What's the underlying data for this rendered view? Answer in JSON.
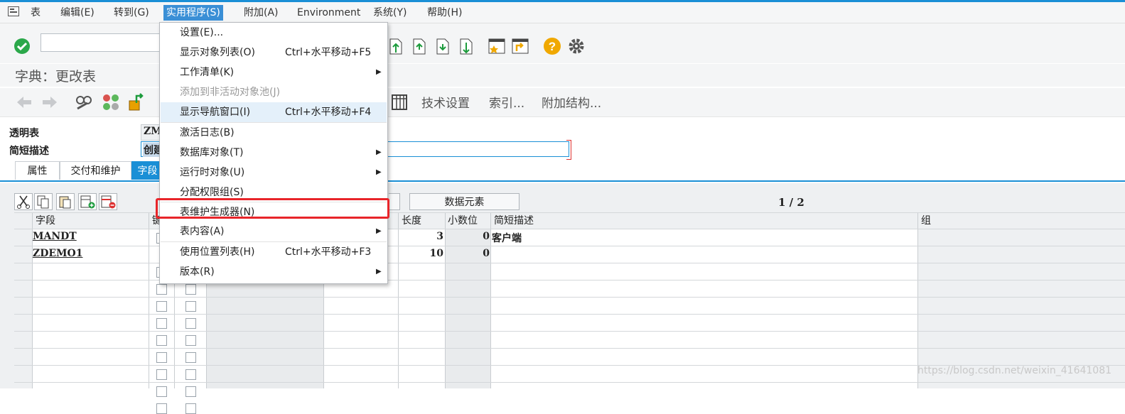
{
  "menubar": {
    "items": [
      "表",
      "编辑(E)",
      "转到(G)",
      "实用程序(S)",
      "附加(A)",
      "Environment",
      "系统(Y)",
      "帮助(H)"
    ]
  },
  "title": "字典：更改表",
  "app_toolbar": {
    "tech_settings": "技术设置",
    "index": "索引...",
    "append_struct": "附加结构..."
  },
  "fields": {
    "transparent_table_label": "透明表",
    "transparent_table_value": "ZM",
    "short_desc_label": "简短描述",
    "short_desc_value": "创建"
  },
  "tabs": [
    "属性",
    "交付和维护",
    "字段"
  ],
  "data_element_button": "数据元素",
  "pager": "1 / 2",
  "table": {
    "headers": {
      "field": "字段",
      "key": "键",
      "length": "长度",
      "decimals": "小数位",
      "short_desc": "简短描述",
      "group": "组"
    },
    "rows": [
      {
        "field": "MANDT",
        "length": "3",
        "decimals": "0",
        "desc": "客户端"
      },
      {
        "field": "ZDEMO1",
        "length": "10",
        "decimals": "0",
        "desc": ""
      }
    ]
  },
  "dropdown": {
    "items": [
      {
        "label": "设置(E)...",
        "shortcut": "",
        "submenu": false,
        "disabled": false
      },
      {
        "label": "显示对象列表(O)",
        "shortcut": "Ctrl+水平移动+F5",
        "submenu": false,
        "disabled": false
      },
      {
        "label": "工作清单(K)",
        "shortcut": "",
        "submenu": true,
        "disabled": false
      },
      {
        "label": "添加到非活动对象池(J)",
        "shortcut": "",
        "submenu": false,
        "disabled": true
      },
      {
        "label": "显示导航窗口(I)",
        "shortcut": "Ctrl+水平移动+F4",
        "submenu": false,
        "disabled": false
      },
      {
        "label": "激活日志(B)",
        "shortcut": "",
        "submenu": false,
        "disabled": false
      },
      {
        "label": "数据库对象(T)",
        "shortcut": "",
        "submenu": true,
        "disabled": false
      },
      {
        "label": "运行时对象(U)",
        "shortcut": "",
        "submenu": true,
        "disabled": false
      },
      {
        "label": "分配权限组(S)",
        "shortcut": "",
        "submenu": false,
        "disabled": false
      },
      {
        "label": "表维护生成器(N)",
        "shortcut": "",
        "submenu": false,
        "disabled": false
      },
      {
        "label": "表内容(A)",
        "shortcut": "",
        "submenu": true,
        "disabled": false
      },
      {
        "label": "使用位置列表(H)",
        "shortcut": "Ctrl+水平移动+F3",
        "submenu": false,
        "disabled": false
      },
      {
        "label": "版本(R)",
        "shortcut": "",
        "submenu": true,
        "disabled": false
      }
    ]
  },
  "watermark": "https://blog.csdn.net/weixin_41641081",
  "colors": {
    "accent": "#1a8fd6",
    "highlight": "#e8252a",
    "menu_active": "#3a8fd6"
  }
}
